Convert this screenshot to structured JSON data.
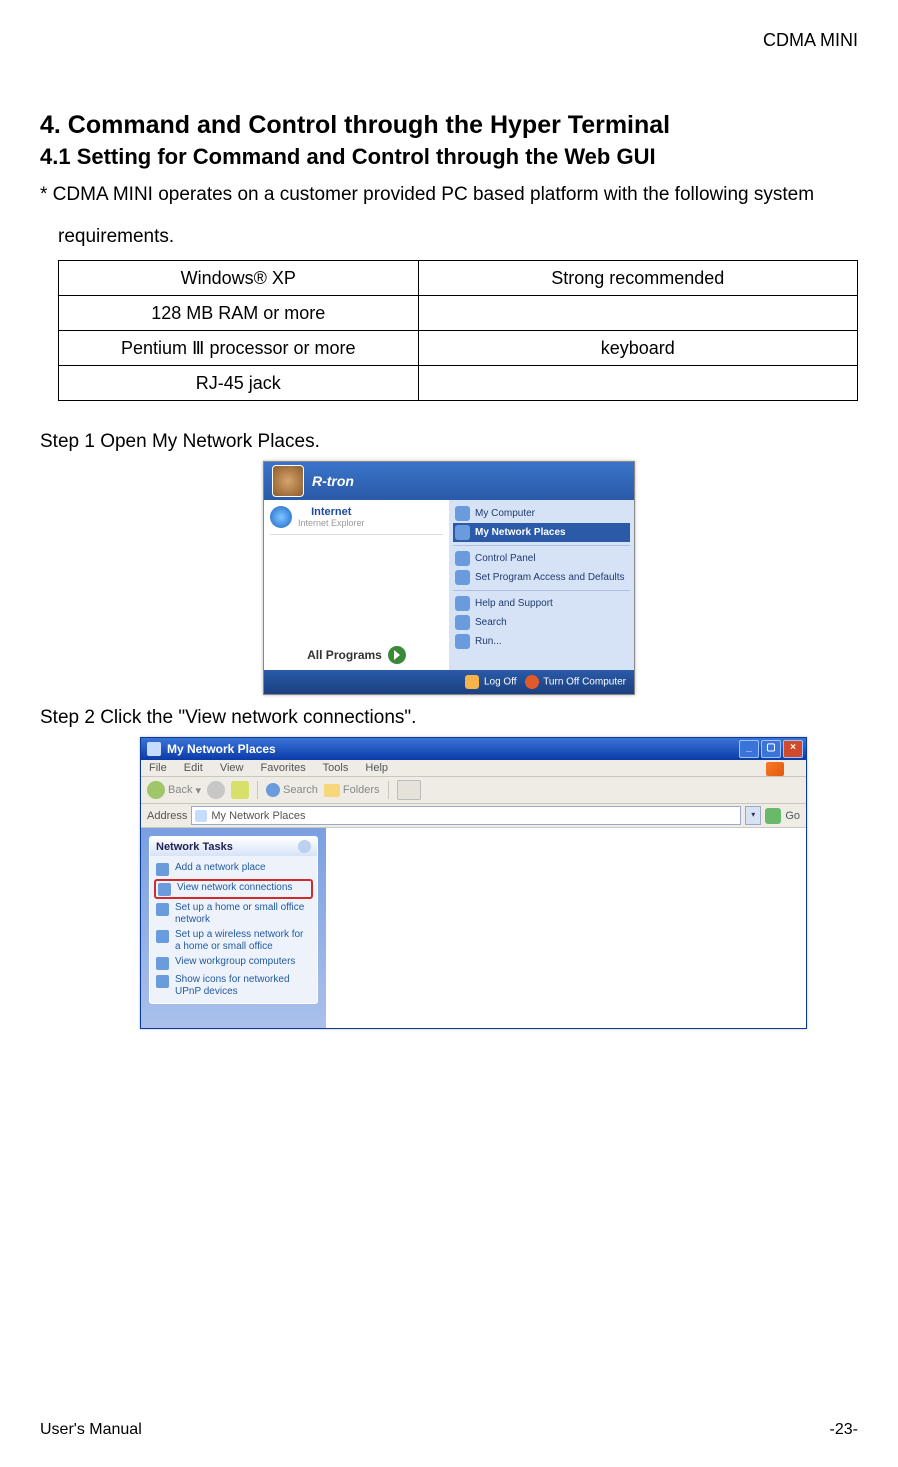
{
  "header_right": "CDMA MINI",
  "section_title": "4. Command and Control through the Hyper Terminal",
  "subsection_title": "4.1 Setting for Command and Control through the Web GUI",
  "intro_line": "* CDMA MINI operates on a customer provided PC based platform with the following system",
  "intro_line2": "requirements.",
  "req_table": {
    "rows": [
      {
        "c1": "Windows® XP",
        "c2": "Strong recommended"
      },
      {
        "c1": "128 MB RAM or more",
        "c2": ""
      },
      {
        "c1": "Pentium Ⅲ processor or more",
        "c2": "keyboard"
      },
      {
        "c1": "RJ-45 jack",
        "c2": ""
      }
    ]
  },
  "step1": "Step 1 Open My Network Places.",
  "step2": "Step 2 Click the \"View network connections\".",
  "fig1": {
    "user": "R-tron",
    "ie": {
      "l1": "Internet",
      "l2": "Internet Explorer"
    },
    "right_items": {
      "i0": "My Computer",
      "i1": "My Network Places",
      "i2": "Control Panel",
      "i3": "Set Program Access and Defaults",
      "i4": "Help and Support",
      "i5": "Search",
      "i6": "Run..."
    },
    "all_programs": "All Programs",
    "logoff": "Log Off",
    "turnoff": "Turn Off Computer"
  },
  "fig2": {
    "title": "My Network Places",
    "menu": {
      "m0": "File",
      "m1": "Edit",
      "m2": "View",
      "m3": "Favorites",
      "m4": "Tools",
      "m5": "Help"
    },
    "tb_back": "Back",
    "tb_search": "Search",
    "tb_folders": "Folders",
    "addr_label": "Address",
    "addr_value": "My Network Places",
    "go": "Go",
    "panel_title": "Network Tasks",
    "tasks": {
      "t0": "Add a network place",
      "t1": "View network connections",
      "t2": "Set up a home or small office network",
      "t3": "Set up a wireless network for a home or small office",
      "t4": "View workgroup computers",
      "t5": "Show icons for networked UPnP devices"
    }
  },
  "footer_left": "User's Manual",
  "footer_right": "-23-"
}
